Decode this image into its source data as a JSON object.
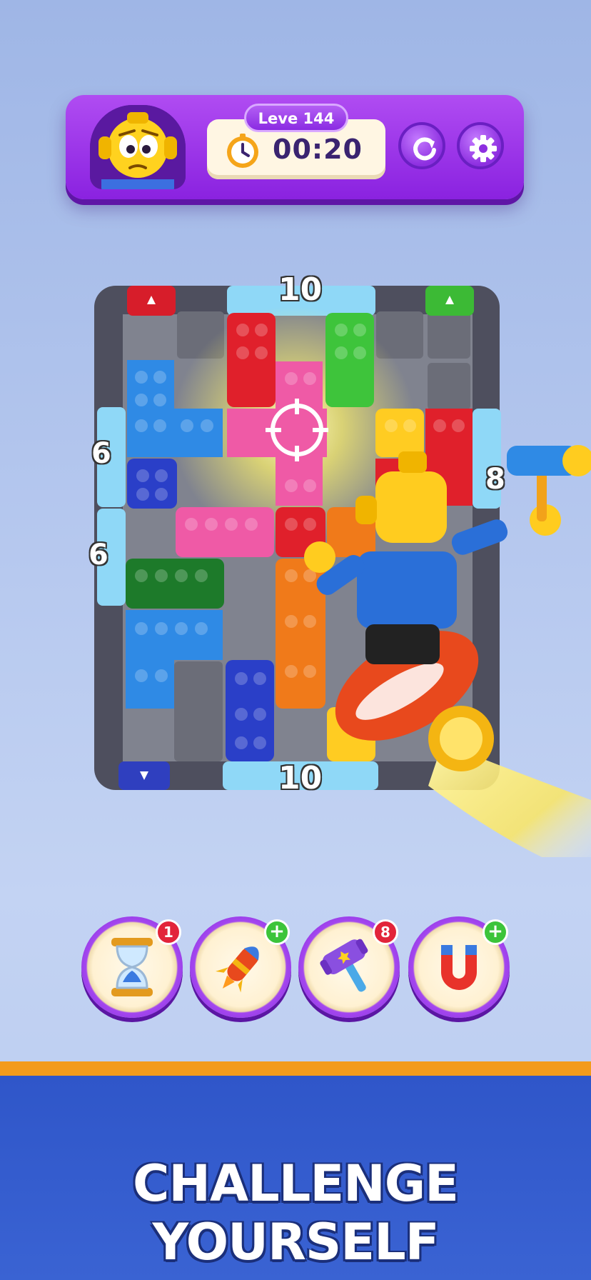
{
  "hud": {
    "level_label": "Leve 144",
    "timer": "00:20",
    "restart_icon": "restart-icon",
    "settings_icon": "gear-icon",
    "avatar_icon": "robot-avatar-icon"
  },
  "board": {
    "top_count": "10",
    "bottom_count": "10",
    "left_top_count": "6",
    "left_bottom_count": "6",
    "right_count": "8"
  },
  "boosters": [
    {
      "name": "hourglass-icon",
      "badge": "1",
      "badge_type": "count"
    },
    {
      "name": "rocket-icon",
      "badge": "+",
      "badge_type": "add"
    },
    {
      "name": "hammer-icon",
      "badge": "8",
      "badge_type": "count"
    },
    {
      "name": "magnet-icon",
      "badge": "+",
      "badge_type": "add"
    }
  ],
  "banner": {
    "text": "CHALLENGE YOURSELF"
  },
  "colors": {
    "hud_purple": "#9a36ea",
    "banner_blue": "#3159cb",
    "banner_stripe": "#f39b1c"
  }
}
